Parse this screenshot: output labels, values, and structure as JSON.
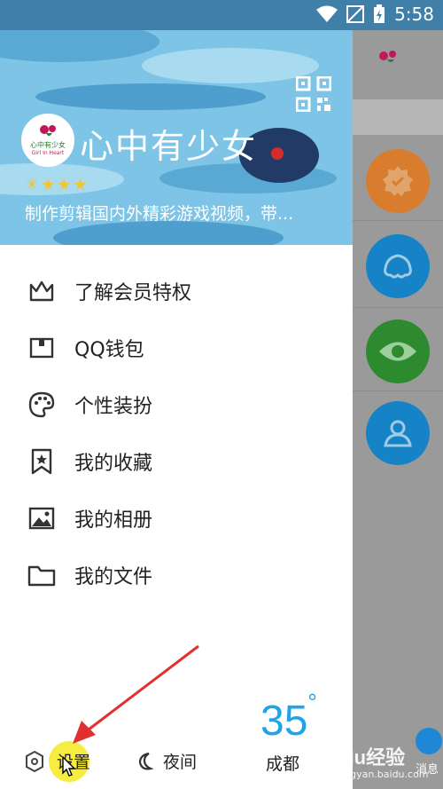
{
  "status_bar": {
    "time": "5:58"
  },
  "profile": {
    "nickname": "心中有少女",
    "avatar_text_cn": "心中有少女",
    "avatar_text_en": "Girl In Heart",
    "signature": "制作剪辑国内外精彩游戏视频，带..."
  },
  "menu": [
    {
      "label": "了解会员特权",
      "icon": "crown-icon"
    },
    {
      "label": "QQ钱包",
      "icon": "wallet-icon"
    },
    {
      "label": "个性装扮",
      "icon": "palette-icon"
    },
    {
      "label": "我的收藏",
      "icon": "bookmark-star-icon"
    },
    {
      "label": "我的相册",
      "icon": "photo-icon"
    },
    {
      "label": "我的文件",
      "icon": "folder-icon"
    }
  ],
  "bottom": {
    "settings_label": "设置",
    "night_label": "夜间",
    "temperature": "35",
    "degree": "°",
    "city": "成都"
  },
  "behind": {
    "message_label": "消息"
  },
  "watermark": {
    "text": "Baidu经验",
    "sub": "jingyan.baidu.com"
  },
  "colors": {
    "header_bg": "#7ec4e6",
    "accent_blue": "#1ea4e8",
    "orange": "#f0913a",
    "green": "#3f9a3a",
    "highlight_yellow": "#f5ea1f",
    "arrow_red": "#e03030"
  }
}
